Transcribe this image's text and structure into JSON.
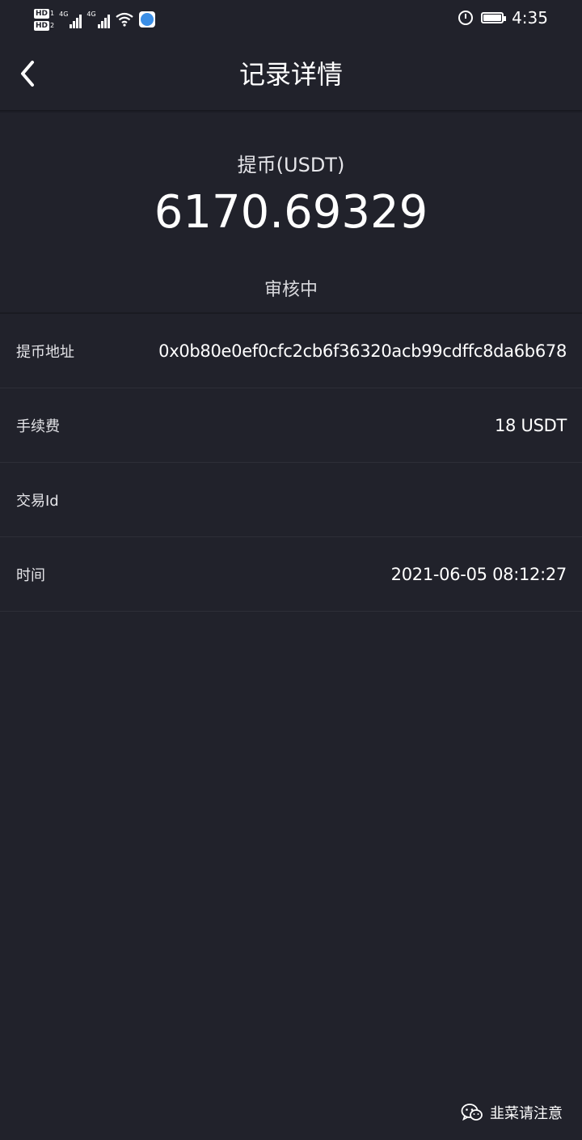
{
  "status_bar": {
    "left": {
      "hd1": "HD",
      "hd1_num": "1",
      "hd2": "HD",
      "hd2_num": "2",
      "sig1": "4G",
      "sig2": "4G"
    },
    "time": "4:35"
  },
  "header": {
    "title": "记录详情"
  },
  "summary": {
    "label": "提币(USDT)",
    "amount": "6170.69329",
    "status": "审核中"
  },
  "details": [
    {
      "label": "提币地址",
      "value": "0x0b80e0ef0cfc2cb6f36320acb99cdffc8da6b678"
    },
    {
      "label": "手续费",
      "value": "18 USDT"
    },
    {
      "label": "交易Id",
      "value": ""
    },
    {
      "label": "时间",
      "value": "2021-06-05 08:12:27"
    }
  ],
  "watermark": {
    "text": "韭菜请注意",
    "icon": "wechat-icon"
  }
}
